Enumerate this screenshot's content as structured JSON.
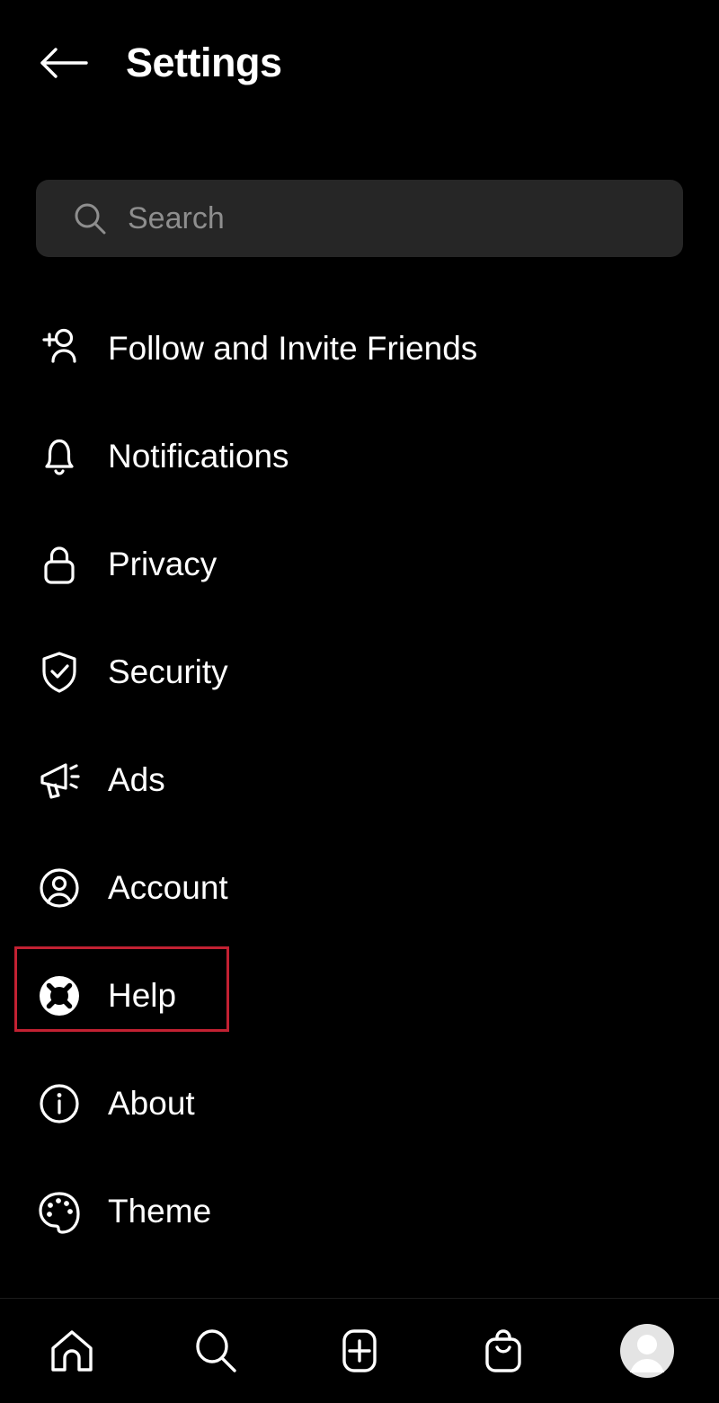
{
  "header": {
    "back_icon": "arrow-left-icon",
    "title": "Settings"
  },
  "search": {
    "icon": "search-icon",
    "placeholder": "Search",
    "value": ""
  },
  "settings": {
    "items": [
      {
        "label": "Follow and Invite Friends",
        "icon": "person-add-icon",
        "highlighted": false
      },
      {
        "label": "Notifications",
        "icon": "bell-icon",
        "highlighted": false
      },
      {
        "label": "Privacy",
        "icon": "lock-icon",
        "highlighted": false
      },
      {
        "label": "Security",
        "icon": "shield-check-icon",
        "highlighted": false
      },
      {
        "label": "Ads",
        "icon": "megaphone-icon",
        "highlighted": false
      },
      {
        "label": "Account",
        "icon": "account-circle-icon",
        "highlighted": false
      },
      {
        "label": "Help",
        "icon": "lifebuoy-icon",
        "highlighted": true
      },
      {
        "label": "About",
        "icon": "info-circle-icon",
        "highlighted": false
      },
      {
        "label": "Theme",
        "icon": "palette-icon",
        "highlighted": false
      }
    ]
  },
  "bottom_nav": {
    "items": [
      {
        "name": "home",
        "icon": "home-icon"
      },
      {
        "name": "search",
        "icon": "search-icon"
      },
      {
        "name": "create",
        "icon": "plus-square-icon"
      },
      {
        "name": "shop",
        "icon": "shopping-bag-icon"
      },
      {
        "name": "profile",
        "icon": "avatar-icon"
      }
    ]
  },
  "colors": {
    "background": "#000000",
    "text": "#ffffff",
    "placeholder": "#8e8e8e",
    "search_field": "#262626",
    "highlight_border": "#c22132",
    "avatar": "#e4e4e4"
  }
}
